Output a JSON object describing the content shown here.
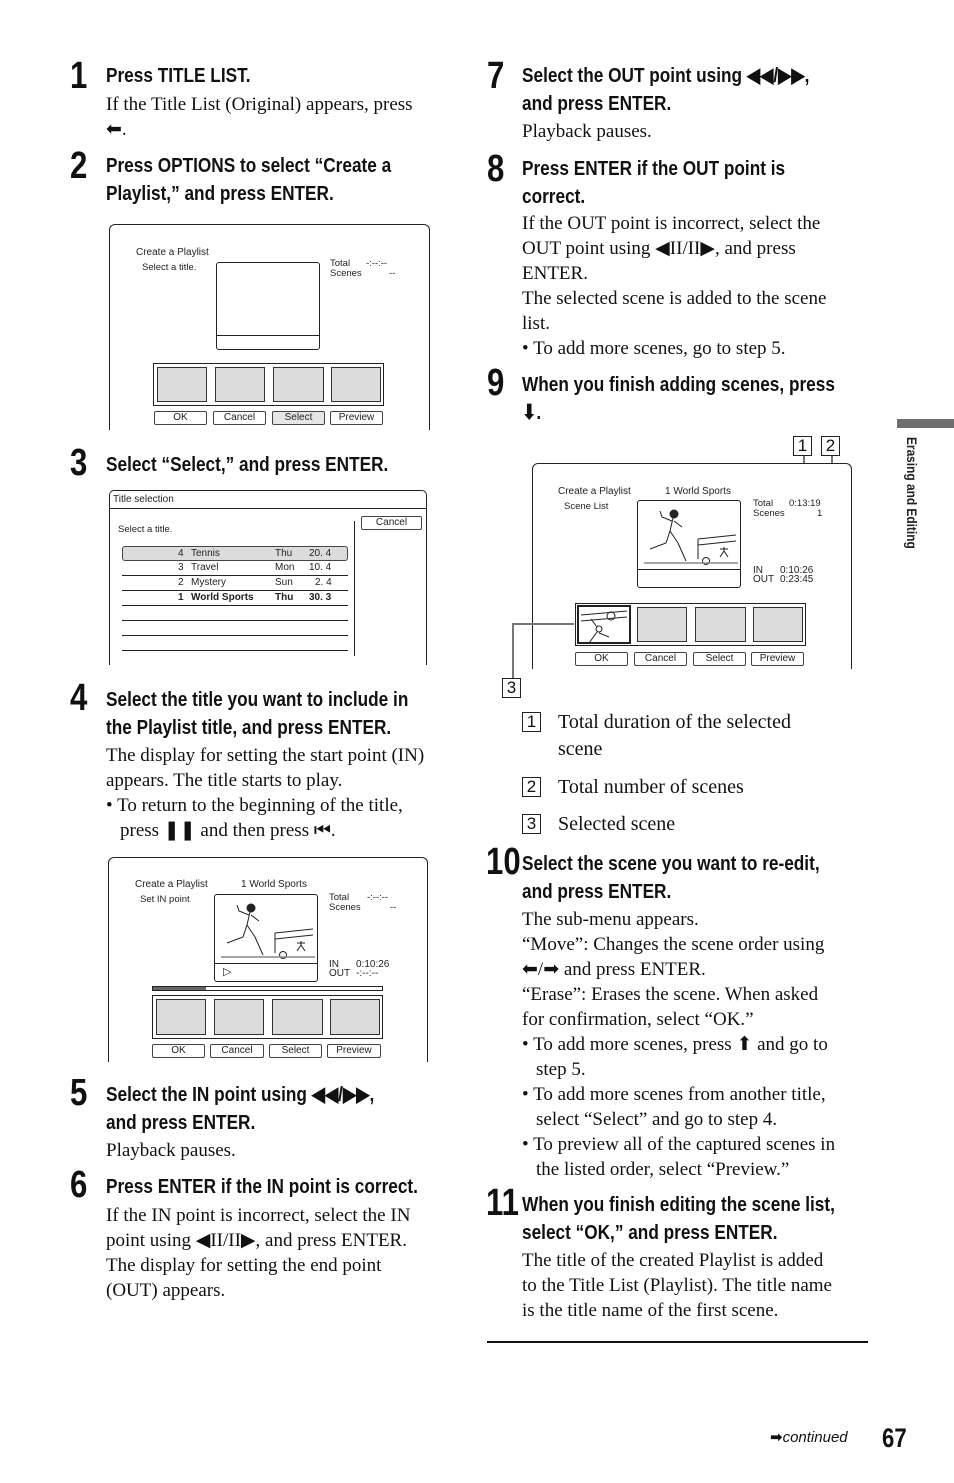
{
  "side_tab": {
    "label": "Erasing and Editing"
  },
  "footer": {
    "continued_label": "continued",
    "page_number": "67"
  },
  "steps": [
    {
      "num": "1",
      "heading": "Press TITLE LIST.",
      "body": [
        "If the Title List (Original) appears, press",
        "⬅."
      ]
    },
    {
      "num": "2",
      "heading_lines": [
        "Press OPTIONS to select “Create a",
        "Playlist,” and press ENTER."
      ]
    },
    {
      "num": "3",
      "heading": "Select “Select,” and press ENTER."
    },
    {
      "num": "4",
      "heading_lines": [
        "Select the title you want to include in",
        "the Playlist title, and press ENTER."
      ],
      "body": [
        "The display for setting the start point (IN)",
        "appears. The title starts to play."
      ],
      "bullets": [
        "To return to the beginning of the title,",
        "press ❚❚ and then press ⏮."
      ]
    },
    {
      "num": "5",
      "heading_lines": [
        "Select the IN point using ◀◀/▶▶,",
        "and press ENTER."
      ],
      "body": [
        "Playback pauses."
      ]
    },
    {
      "num": "6",
      "heading": "Press ENTER if the IN point is correct.",
      "body": [
        "If the IN point is incorrect, select the IN",
        "point using ◀II/II▶, and press ENTER.",
        "The display for setting the end point",
        "(OUT) appears."
      ]
    },
    {
      "num": "7",
      "heading_lines": [
        "Select the OUT point using ◀◀/▶▶,",
        "and press ENTER."
      ],
      "body": [
        "Playback pauses."
      ]
    },
    {
      "num": "8",
      "heading_lines": [
        "Press ENTER if the OUT point is",
        "correct."
      ],
      "body": [
        "If the OUT point is incorrect, select the",
        "OUT point using ◀II/II▶, and press",
        "ENTER.",
        "The selected scene is added to the scene",
        "list."
      ],
      "bullets": [
        "To add more scenes, go to step 5."
      ]
    },
    {
      "num": "9",
      "heading_lines": [
        "When you finish adding scenes, press",
        "⬇."
      ]
    },
    {
      "num": "10",
      "heading_lines": [
        "Select the scene you want to re-edit,",
        "and press ENTER."
      ],
      "body": [
        "The sub-menu appears.",
        "“Move”: Changes the scene order using",
        "⬅/➡ and press ENTER.",
        "“Erase”: Erases the scene. When asked",
        "for confirmation, select “OK.”"
      ],
      "bullets": [
        "To add more scenes, press ⬆ and go to",
        "step 5.",
        "To add more scenes from another title,",
        "select “Select” and go to step 4.",
        "To preview all of the captured scenes in",
        "the listed order, select “Preview.”"
      ]
    },
    {
      "num": "11",
      "heading_lines": [
        "When you finish editing the scene list,",
        "select “OK,” and press ENTER."
      ],
      "body": [
        "The title of the created Playlist is added",
        "to the Title List (Playlist). The title name",
        "is the title name of the first scene."
      ]
    }
  ],
  "screen_create": {
    "title": "Create a Playlist",
    "subtitle": "Select a title.",
    "total_label": "Total",
    "total_value": "-:--:--",
    "scenes_label": "Scenes",
    "scenes_value": "--",
    "buttons": [
      "OK",
      "Cancel",
      "Select",
      "Preview"
    ],
    "selected_button": "Select"
  },
  "screen_title_selection": {
    "header": "Title selection",
    "prompt": "Select a title.",
    "cancel_label": "Cancel",
    "rows": [
      {
        "num": "4",
        "name": "Tennis",
        "day": "Thu",
        "date": "20. 4",
        "highlighted": true
      },
      {
        "num": "3",
        "name": "Travel",
        "day": "Mon",
        "date": "10. 4"
      },
      {
        "num": "2",
        "name": "Mystery",
        "day": "Sun",
        "date": "2. 4"
      },
      {
        "num": "1",
        "name": "World Sports",
        "day": "Thu",
        "date": "30. 3",
        "bold": true
      }
    ]
  },
  "screen_in_point": {
    "title": "Create a Playlist",
    "title_name": "1 World Sports",
    "subtitle": "Set IN point",
    "total_label": "Total",
    "total_value": "-:--:--",
    "scenes_label": "Scenes",
    "scenes_value": "--",
    "in_label": "IN",
    "in_value": "0:10:26",
    "out_label": "OUT",
    "out_value": "-:--:--",
    "progress_fraction": 0.23,
    "buttons": [
      "OK",
      "Cancel",
      "Select",
      "Preview"
    ]
  },
  "screen_scene_list": {
    "title": "Create a Playlist",
    "title_name": "1 World Sports",
    "subtitle": "Scene List",
    "total_label": "Total",
    "total_value": "0:13:19",
    "scenes_label": "Scenes",
    "scenes_value": "1",
    "in_label": "IN",
    "in_value": "0:10:26",
    "out_label": "OUT",
    "out_value": "0:23:45",
    "buttons": [
      "OK",
      "Cancel",
      "Select",
      "Preview"
    ],
    "callouts": [
      "1",
      "2",
      "3"
    ]
  },
  "legend": [
    {
      "num": "1",
      "text_lines": [
        "Total duration of the selected",
        "scene"
      ]
    },
    {
      "num": "2",
      "text_lines": [
        "Total number of scenes"
      ]
    },
    {
      "num": "3",
      "text_lines": [
        "Selected scene"
      ]
    }
  ]
}
